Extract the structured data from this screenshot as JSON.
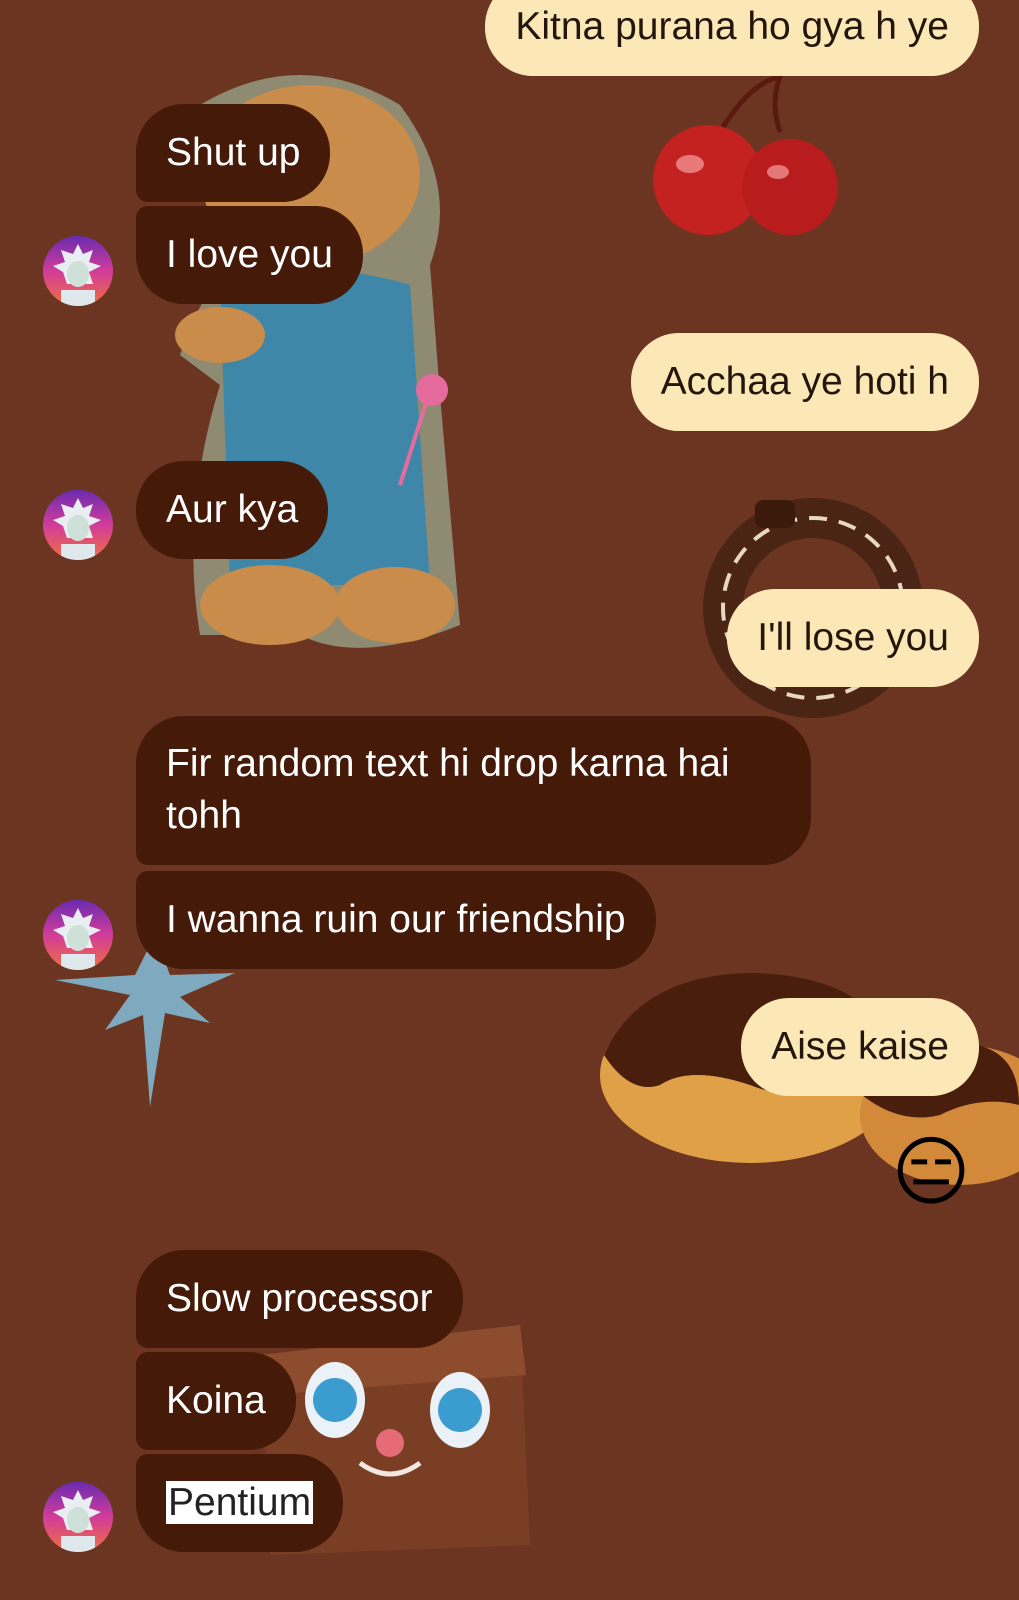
{
  "chat": {
    "messages": [
      {
        "id": "m1",
        "direction": "outgoing",
        "text": "Kitna purana ho gya h ye"
      },
      {
        "id": "m2",
        "direction": "incoming",
        "text": "Shut up"
      },
      {
        "id": "m3",
        "direction": "incoming",
        "text": "I love you"
      },
      {
        "id": "m4",
        "direction": "outgoing",
        "text": "Acchaa ye hoti h"
      },
      {
        "id": "m5",
        "direction": "incoming",
        "text": "Aur kya"
      },
      {
        "id": "m6",
        "direction": "outgoing",
        "text": "I'll lose you"
      },
      {
        "id": "m7",
        "direction": "incoming",
        "text": "Fir random text hi drop karna hai tohh"
      },
      {
        "id": "m8",
        "direction": "incoming",
        "text": "I wanna ruin our friendship"
      },
      {
        "id": "m9",
        "direction": "outgoing",
        "text": "Aise kaise"
      },
      {
        "id": "m10",
        "direction": "outgoing",
        "emoji": "😑"
      },
      {
        "id": "m11",
        "direction": "incoming",
        "text": "Slow processor"
      },
      {
        "id": "m12",
        "direction": "incoming",
        "text": "Koina"
      },
      {
        "id": "m13",
        "direction": "incoming",
        "text": "Pentium",
        "selected": true
      }
    ]
  },
  "avatar": {
    "icon": "cartoon-scientist-avatar"
  },
  "colors": {
    "background": "#6b3522",
    "incoming_bubble": "#451a08",
    "outgoing_bubble": "#fce8b6",
    "selection_highlight": "#ffffff"
  }
}
